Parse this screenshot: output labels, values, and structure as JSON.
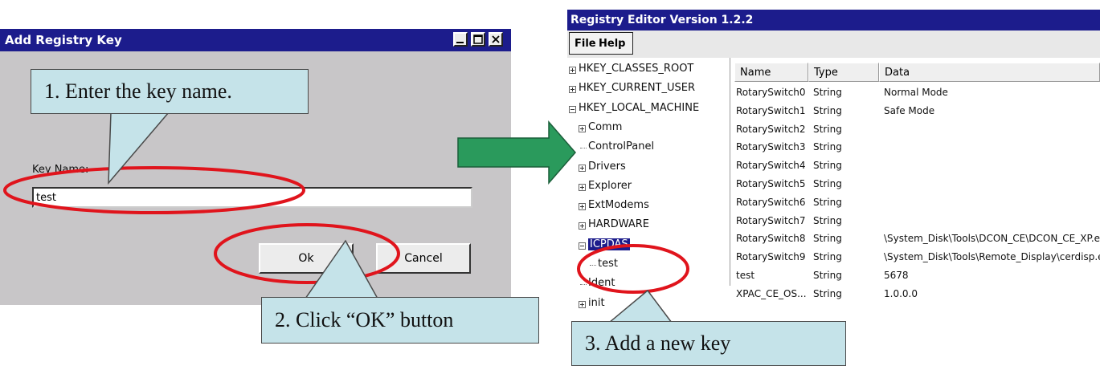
{
  "add_dialog": {
    "title": "Add Registry Key",
    "key_name_label": "Key Name:",
    "key_name_value": "test",
    "ok_label": "Ok",
    "cancel_label": "Cancel"
  },
  "registry_editor": {
    "title": "Registry Editor Version 1.2.2",
    "menu": [
      "File",
      "Help"
    ],
    "tree": [
      {
        "label": "HKEY_CLASSES_ROOT",
        "expander": "plus"
      },
      {
        "label": "HKEY_CURRENT_USER",
        "expander": "plus"
      },
      {
        "label": "HKEY_LOCAL_MACHINE",
        "expander": "minus"
      },
      {
        "label": "Comm",
        "expander": "plus"
      },
      {
        "label": "ControlPanel",
        "expander": "none"
      },
      {
        "label": "Drivers",
        "expander": "plus"
      },
      {
        "label": "Explorer",
        "expander": "plus"
      },
      {
        "label": "ExtModems",
        "expander": "plus"
      },
      {
        "label": "HARDWARE",
        "expander": "plus"
      },
      {
        "label": "ICPDAS",
        "expander": "minus",
        "selected": true
      },
      {
        "label": "test",
        "expander": "none"
      },
      {
        "label": "Ident",
        "expander": "none"
      },
      {
        "label": "init",
        "expander": "plus"
      }
    ],
    "columns": [
      "Name",
      "Type",
      "Data"
    ],
    "rows": [
      {
        "name": "RotarySwitch0",
        "type": "String",
        "data": "Normal Mode"
      },
      {
        "name": "RotarySwitch1",
        "type": "String",
        "data": "Safe Mode"
      },
      {
        "name": "RotarySwitch2",
        "type": "String",
        "data": ""
      },
      {
        "name": "RotarySwitch3",
        "type": "String",
        "data": ""
      },
      {
        "name": "RotarySwitch4",
        "type": "String",
        "data": ""
      },
      {
        "name": "RotarySwitch5",
        "type": "String",
        "data": ""
      },
      {
        "name": "RotarySwitch6",
        "type": "String",
        "data": ""
      },
      {
        "name": "RotarySwitch7",
        "type": "String",
        "data": ""
      },
      {
        "name": "RotarySwitch8",
        "type": "String",
        "data": "\\System_Disk\\Tools\\DCON_CE\\DCON_CE_XP.exe"
      },
      {
        "name": "RotarySwitch9",
        "type": "String",
        "data": "\\System_Disk\\Tools\\Remote_Display\\cerdisp.exe"
      },
      {
        "name": "test",
        "type": "String",
        "data": "5678"
      },
      {
        "name": "XPAC_CE_OS...",
        "type": "String",
        "data": "1.0.0.0"
      }
    ]
  },
  "callouts": {
    "step1": "1. Enter the key name.",
    "step2": "2. Click “OK” button",
    "step3": "3. Add a new key"
  },
  "colors": {
    "title_bar": "#1c1c8c",
    "dialog_bg": "#c8c6c8",
    "callout_fill": "#c5e3e9",
    "highlight_ellipse": "#e0141c",
    "arrow_green": "#2a9a5c"
  },
  "icons": [
    "minimize-icon",
    "maximize-icon",
    "close-icon",
    "tree-expand-icon",
    "tree-collapse-icon",
    "green-arrow-icon"
  ]
}
